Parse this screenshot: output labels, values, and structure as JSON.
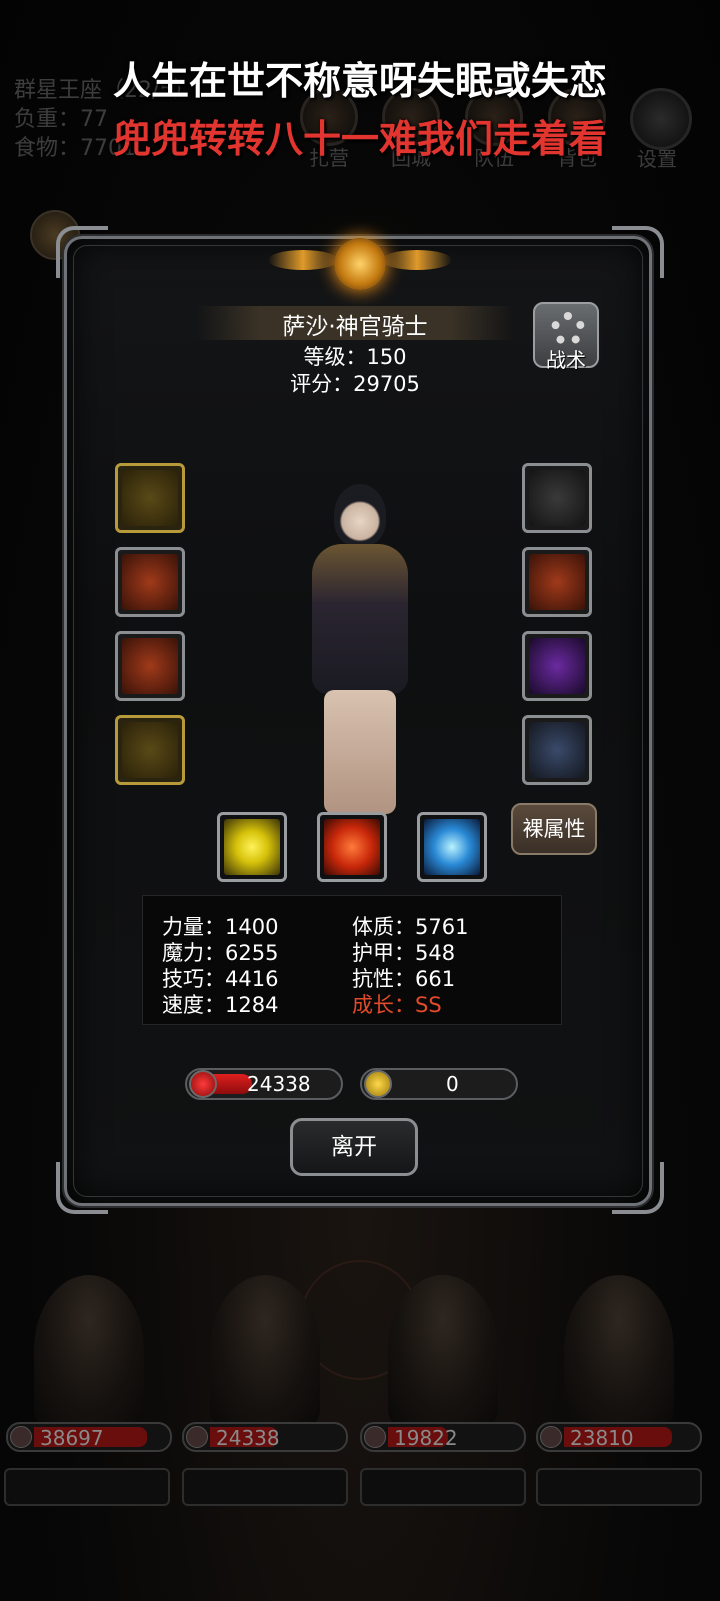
{
  "hud": {
    "line1": "群星王座（22/5）",
    "line2": "负重：77",
    "line3": "食物：7701",
    "buttons": [
      "扎营",
      "回城",
      "队伍",
      "背包",
      "设置"
    ]
  },
  "lyrics": {
    "line1": "人生在世不称意呀失眠或失恋",
    "line2": "兜兜转转八十一难我们走着看"
  },
  "character": {
    "name": "萨沙·神官骑士",
    "level": "等级：150",
    "score": "评分：29705",
    "tactics_label": "战术",
    "bare_label": "裸属性"
  },
  "equipment": {
    "left": [
      {
        "icon": "mace-icon",
        "frame": "gold"
      },
      {
        "icon": "armor-icon",
        "frame": "silver"
      },
      {
        "icon": "demon-helm-icon",
        "frame": "silver"
      },
      {
        "icon": "golden-amulet-icon",
        "frame": "gold"
      }
    ],
    "right": [
      {
        "icon": "golden-ring-icon",
        "frame": "silver"
      },
      {
        "icon": "ruby-ring-icon",
        "frame": "silver"
      },
      {
        "icon": "arcane-tome-icon",
        "frame": "silver"
      },
      {
        "icon": "lantern-icon",
        "frame": "silver"
      }
    ]
  },
  "skills": [
    "fist-skill-icon",
    "heal-cross-skill-icon",
    "eye-skill-icon"
  ],
  "stats": {
    "strength": "力量：1400",
    "magic": "魔力：6255",
    "skill": "技巧：4416",
    "speed": "速度：1284",
    "constitution": "体质：5761",
    "armor": "护甲：548",
    "resistance": "抗性：661",
    "growth": "成长：SS"
  },
  "bars": {
    "hp": "24338",
    "hp_fill": 0.3,
    "energy": "0"
  },
  "leave_label": "离开",
  "party": [
    {
      "hp": "38697",
      "fill": 0.75
    },
    {
      "hp": "24338",
      "fill": 0.45
    },
    {
      "hp": "19822",
      "fill": 0.4
    },
    {
      "hp": "23810",
      "fill": 0.72
    }
  ],
  "colors": {
    "accent_gold": "#b79a3a",
    "hp_red": "#e02020",
    "growth_red": "#e24a2a",
    "lyric_red": "#e23530"
  }
}
